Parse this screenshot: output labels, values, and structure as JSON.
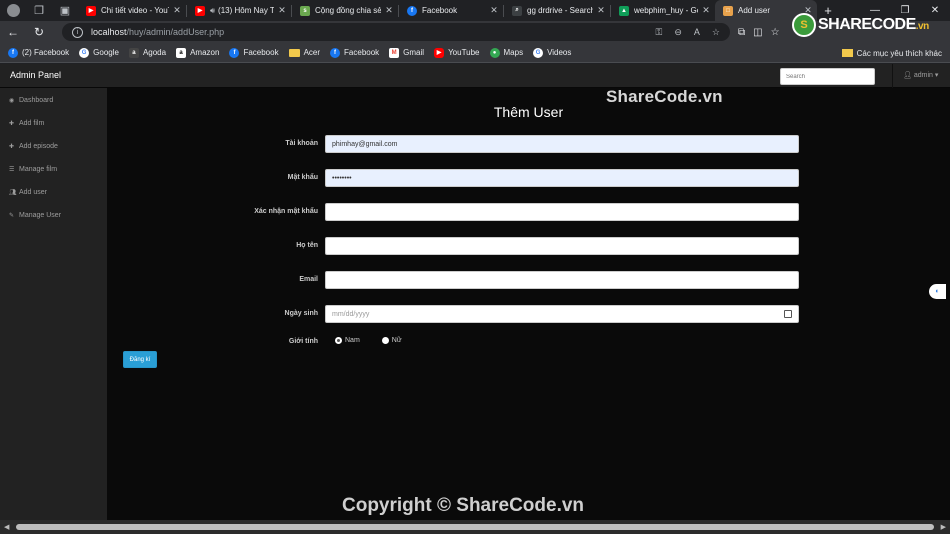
{
  "browser": {
    "tabs": [
      {
        "title": "Chi tiết video - YouT",
        "favicon_color": "#ff0000",
        "active": false
      },
      {
        "title": "(13) Hôm Nay Tô",
        "favicon_color": "#ff0000",
        "active": false,
        "audio": true
      },
      {
        "title": "Cộng đồng chia sẻ",
        "favicon_color": "#6aa84f",
        "active": false
      },
      {
        "title": "Facebook",
        "favicon_color": "#1877f2",
        "active": false
      },
      {
        "title": "gg drdrive - Search",
        "favicon_color": "#3c4043",
        "active": false
      },
      {
        "title": "webphim_huy - Goo",
        "favicon_color": "#0f9d58",
        "active": false
      },
      {
        "title": "Add user",
        "favicon_color": "#e8a24c",
        "active": true
      }
    ],
    "address": {
      "host": "localhost",
      "path": "/huy/admin/addUser.php"
    },
    "bookmarks": [
      {
        "label": "(2) Facebook",
        "icon": "facebook-icon",
        "color": "#1877f2"
      },
      {
        "label": "Google",
        "icon": "google-icon",
        "color": "#ffffff"
      },
      {
        "label": "Agoda",
        "icon": "agoda-icon",
        "color": "#444444"
      },
      {
        "label": "Amazon",
        "icon": "amazon-icon",
        "color": "#ffffff"
      },
      {
        "label": "Facebook",
        "icon": "facebook-icon",
        "color": "#1877f2"
      },
      {
        "label": "Acer",
        "icon": "folder-icon",
        "color": "#f2c94c"
      },
      {
        "label": "Facebook",
        "icon": "facebook-icon",
        "color": "#1877f2"
      },
      {
        "label": "Gmail",
        "icon": "gmail-icon",
        "color": "#ea4335"
      },
      {
        "label": "YouTube",
        "icon": "youtube-icon",
        "color": "#ff0000"
      },
      {
        "label": "Maps",
        "icon": "maps-icon",
        "color": "#34a853"
      },
      {
        "label": "Videos",
        "icon": "google-icon",
        "color": "#ffffff"
      }
    ],
    "bookmarks_other": "Các mục yêu thích khác"
  },
  "admin": {
    "brand": "Admin Panel",
    "search_placeholder": "Search",
    "user": "admin"
  },
  "sidebar": {
    "items": [
      {
        "label": "Dashboard",
        "icon": "dashboard-icon"
      },
      {
        "label": "Add film",
        "icon": "plus-icon"
      },
      {
        "label": "Add episode",
        "icon": "plus-icon"
      },
      {
        "label": "Manage film",
        "icon": "list-icon"
      },
      {
        "label": "Add user",
        "icon": "user-plus-icon"
      },
      {
        "label": "Manage User",
        "icon": "edit-icon"
      }
    ]
  },
  "form": {
    "title": "Thêm User",
    "fields": {
      "account": {
        "label": "Tài khoản",
        "value": "phimhay@gmail.com"
      },
      "password": {
        "label": "Mật khẩu",
        "value": "••••••••"
      },
      "confirm": {
        "label": "Xác nhận mật khẩu",
        "value": ""
      },
      "fullname": {
        "label": "Họ tên",
        "value": ""
      },
      "email": {
        "label": "Email",
        "value": ""
      },
      "dob": {
        "label": "Ngày sinh",
        "placeholder": "mm/dd/yyyy"
      },
      "gender": {
        "label": "Giới tính",
        "options": [
          "Nam",
          "Nữ"
        ],
        "selected": "Nam"
      }
    },
    "submit": "Đăng kí"
  },
  "watermark": {
    "top": "ShareCode.vn",
    "bottom": "Copyright © ShareCode.vn",
    "logo_main": "SHARECODE",
    "logo_suffix": ".vn"
  }
}
